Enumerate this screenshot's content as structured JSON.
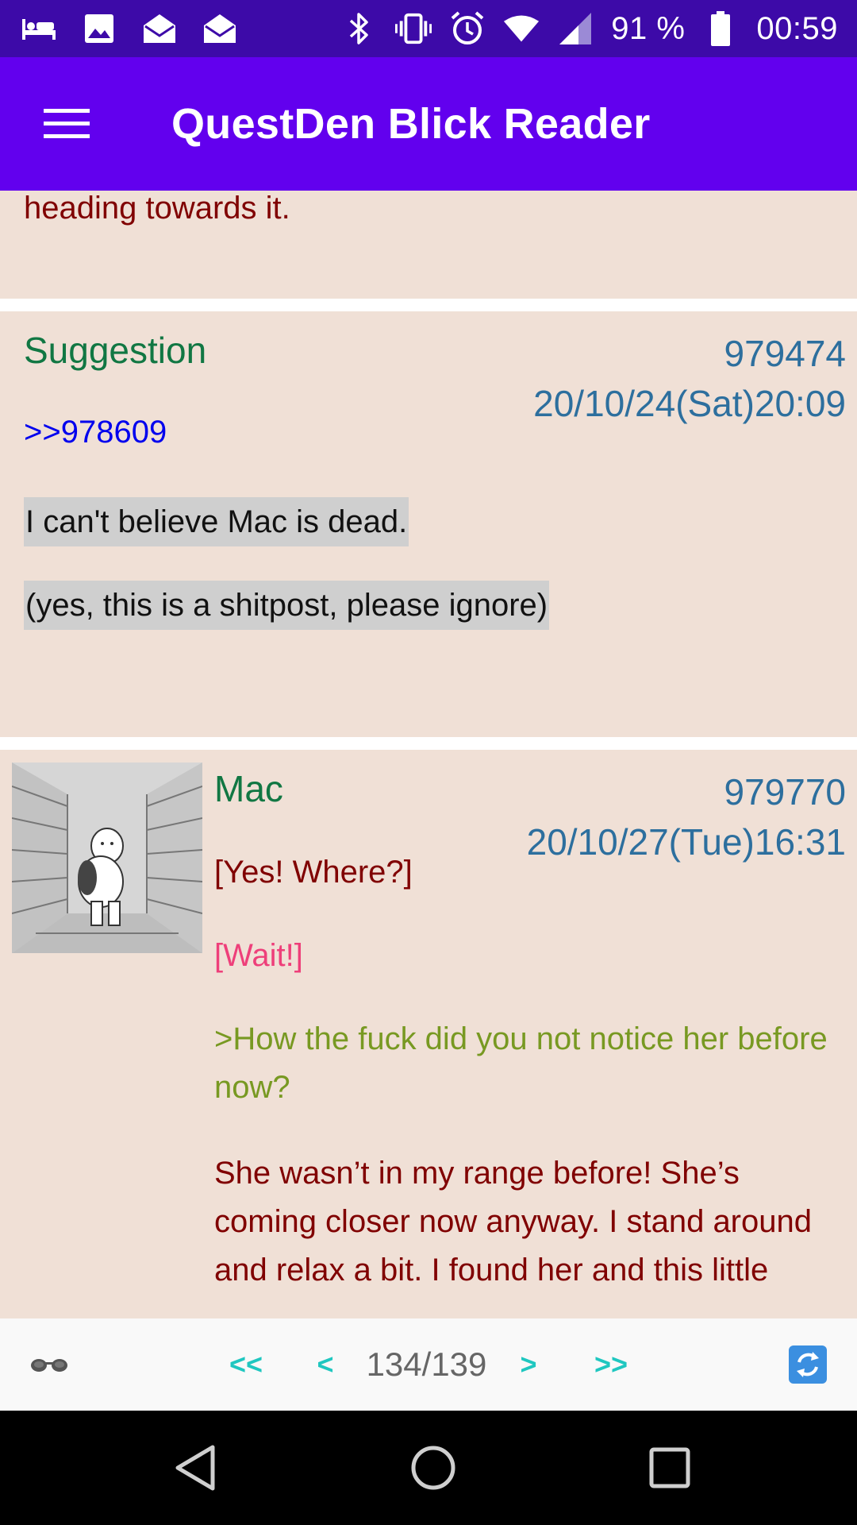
{
  "status_bar": {
    "battery": "91 %",
    "time": "00:59",
    "icons": [
      "bed-icon",
      "image-icon",
      "mail-open-icon",
      "mail-open-icon",
      "bluetooth-icon",
      "vibrate-icon",
      "alarm-icon",
      "wifi-icon",
      "cell-signal-icon",
      "battery-icon"
    ]
  },
  "app_bar": {
    "title": "QuestDen Blick Reader",
    "menu_icon": "hamburger-menu-icon"
  },
  "posts": [
    {
      "text": "heading towards it."
    },
    {
      "name": "Suggestion",
      "number": "979474",
      "date": "20/10/24(Sat)20:09",
      "quote_link": ">>978609",
      "lines": [
        "I can't believe Mac is dead.",
        "(yes, this is a shitpost, please ignore)"
      ]
    },
    {
      "name": "Mac",
      "number": "979770",
      "date": "20/10/27(Tue)16:31",
      "line1": "[Yes! Where?]",
      "line2": "[Wait!]",
      "greentext": ">How the fuck did you not notice her before now?",
      "body": "She wasn’t in my range before! She’s coming closer now anyway. I stand around and relax a bit. I found her and this little"
    }
  ],
  "toolbar": {
    "first": "<<",
    "prev": "<",
    "page": "134/139",
    "next": ">",
    "last": ">>",
    "left_icon": "glasses-icon",
    "right_icon": "refresh-icon"
  },
  "colors": {
    "status_bar": "#3d0aa8",
    "app_bar": "#6200ee",
    "post_bg": "#f0e0d6",
    "name": "#117743",
    "meta": "#2d6f9e",
    "body": "#800000",
    "quote_link": "#0000ee",
    "greentext": "#789922",
    "pink": "#ee3f7a",
    "nav_accent": "#1fc7c0"
  }
}
